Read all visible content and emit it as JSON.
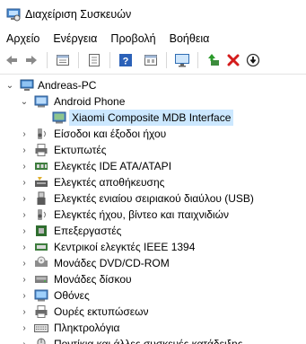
{
  "window": {
    "title": "Διαχείριση Συσκευών",
    "icon": "device-manager-icon"
  },
  "menu": [
    "Αρχείο",
    "Ενέργεια",
    "Προβολή",
    "Βοήθεια"
  ],
  "toolbar": [
    {
      "name": "back-arrow-icon"
    },
    {
      "name": "forward-arrow-icon"
    },
    {
      "name": "properties-grid-icon"
    },
    {
      "name": "show-hidden-icon"
    },
    {
      "name": "help-icon"
    },
    {
      "name": "action-grid-icon"
    },
    {
      "name": "scan-monitor-icon"
    },
    {
      "name": "update-driver-icon"
    },
    {
      "name": "uninstall-x-icon"
    },
    {
      "name": "disable-device-icon"
    }
  ],
  "tree": {
    "root": "Andreas-PC",
    "android_phone": "Android Phone",
    "android_child": "Xiaomi Composite MDB Interface",
    "categories": [
      "Είσοδοι και έξοδοι ήχου",
      "Εκτυπωτές",
      "Ελεγκτές IDE ATA/ATAPI",
      "Ελεγκτές αποθήκευσης",
      "Ελεγκτές ενιαίου σειριακού διαύλου (USB)",
      "Ελεγκτές ήχου, βίντεο και παιχνιδιών",
      "Επεξεργαστές",
      "Κεντρικοί ελεγκτές IEEE 1394",
      "Μονάδες DVD/CD-ROM",
      "Μονάδες δίσκου",
      "Οθόνες",
      "Ουρές εκτυπώσεων",
      "Πληκτρολόγια",
      "Ποντίκια και άλλες συσκευές κατάδειξης"
    ]
  },
  "colors": {
    "selection": "#cce8ff",
    "accent": "#2b79d6"
  }
}
